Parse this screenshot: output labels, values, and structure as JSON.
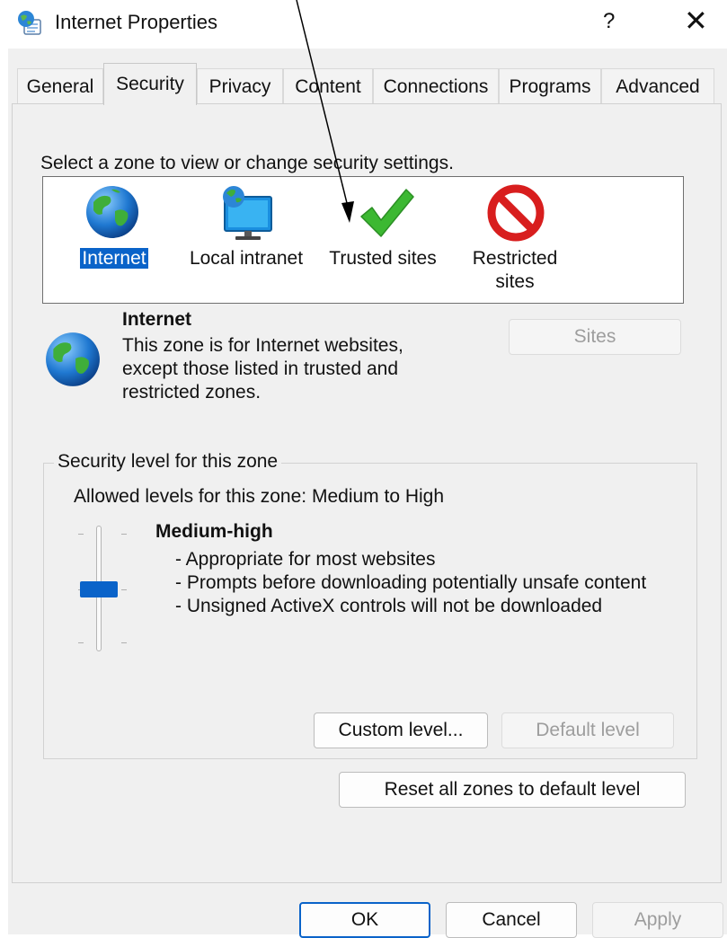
{
  "window": {
    "title": "Internet Properties",
    "help_label": "?",
    "close_label": "✕",
    "icon": "internet-options-icon"
  },
  "tabs": [
    {
      "label": "General",
      "active": false
    },
    {
      "label": "Security",
      "active": true
    },
    {
      "label": "Privacy",
      "active": false
    },
    {
      "label": "Content",
      "active": false
    },
    {
      "label": "Connections",
      "active": false
    },
    {
      "label": "Programs",
      "active": false
    },
    {
      "label": "Advanced",
      "active": false
    }
  ],
  "security": {
    "zone_prompt": "Select a zone to view or change security settings.",
    "zones": [
      {
        "label_line1": "Internet",
        "label_line2": "",
        "icon": "globe-icon",
        "selected": true
      },
      {
        "label_line1": "Local intranet",
        "label_line2": "",
        "icon": "intranet-monitor-icon",
        "selected": false
      },
      {
        "label_line1": "Trusted sites",
        "label_line2": "",
        "icon": "checkmark-icon",
        "selected": false
      },
      {
        "label_line1": "Restricted",
        "label_line2": "sites",
        "icon": "prohibited-icon",
        "selected": false
      }
    ],
    "selected_zone": {
      "name": "Internet",
      "description": "This zone is for Internet websites, except those listed in trusted and restricted zones."
    },
    "sites_button": "Sites",
    "level_group": {
      "legend": "Security level for this zone",
      "allowed": "Allowed levels for this zone: Medium to High",
      "level_name": "Medium-high",
      "bullets": [
        "- Appropriate for most websites",
        "- Prompts before downloading potentially unsafe content",
        "- Unsigned ActiveX controls will not be downloaded"
      ],
      "slider_position": "middle of 3 levels (Medium to High)"
    },
    "custom_level_button": "Custom level...",
    "default_level_button": "Default level",
    "reset_button": "Reset all zones to default level"
  },
  "footer": {
    "ok": "OK",
    "cancel": "Cancel",
    "apply": "Apply"
  },
  "colors": {
    "accent": "#0a63c9",
    "globe_blue": "#1f78d1",
    "check_green": "#3cb832",
    "prohibited_red": "#d81e1e"
  }
}
